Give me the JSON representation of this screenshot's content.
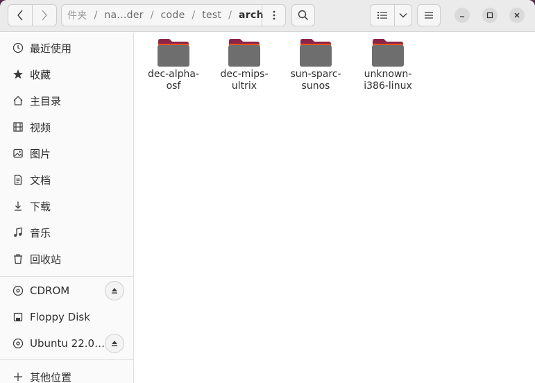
{
  "path": {
    "crumbs": [
      "件夹",
      "na...der",
      "code",
      "test"
    ],
    "current": "arch",
    "separator": "/"
  },
  "icons": {
    "back": "chevron-left-icon",
    "forward": "chevron-right-icon",
    "path_menu": "vertical-dots-icon",
    "search": "search-icon",
    "view_list": "list-view-icon",
    "view_dropdown": "chevron-down-icon",
    "main_menu": "hamburger-icon",
    "minimize": "minimize-icon",
    "maximize": "maximize-icon",
    "close": "close-icon"
  },
  "sidebar": {
    "places": [
      {
        "label": "最近使用",
        "icon": "clock-icon"
      },
      {
        "label": "收藏",
        "icon": "star-icon"
      },
      {
        "label": "主目录",
        "icon": "home-icon"
      },
      {
        "label": "视频",
        "icon": "film-icon"
      },
      {
        "label": "图片",
        "icon": "image-icon"
      },
      {
        "label": "文档",
        "icon": "document-icon"
      },
      {
        "label": "下载",
        "icon": "download-icon"
      },
      {
        "label": "音乐",
        "icon": "music-icon"
      },
      {
        "label": "回收站",
        "icon": "trash-icon"
      }
    ],
    "devices": [
      {
        "label": "CDROM",
        "icon": "disc-icon",
        "ejectable": true
      },
      {
        "label": "Floppy Disk",
        "icon": "floppy-icon",
        "ejectable": false
      },
      {
        "label": "Ubuntu 22.0…",
        "icon": "disc-icon",
        "ejectable": true
      }
    ],
    "other": {
      "label": "其他位置",
      "icon": "plus-icon"
    }
  },
  "files": [
    {
      "line1": "dec-alpha-",
      "line2": "osf"
    },
    {
      "line1": "dec-mips-",
      "line2": "ultrix"
    },
    {
      "line1": "sun-sparc-",
      "line2": "sunos"
    },
    {
      "line1": "unknown-",
      "line2": "i386-linux"
    }
  ],
  "colors": {
    "folder_body": "#6e6e6e",
    "folder_tab": "#8b2547",
    "folder_accent": "#e95420",
    "headerbar": "#ebebeb",
    "sidebar": "#fafafa"
  }
}
